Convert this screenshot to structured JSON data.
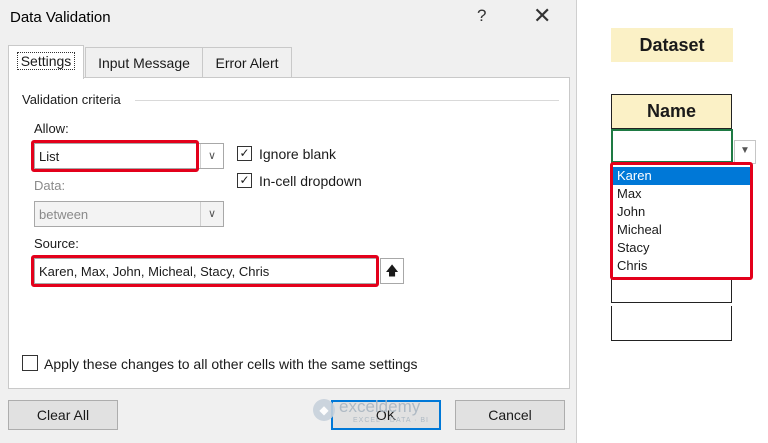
{
  "dialog": {
    "title": "Data Validation",
    "help_glyph": "?",
    "close_glyph": "✕",
    "tabs": [
      {
        "label": "Settings",
        "active": true
      },
      {
        "label": "Input Message",
        "active": false
      },
      {
        "label": "Error Alert",
        "active": false
      }
    ],
    "group_label": "Validation criteria",
    "allow": {
      "label": "Allow:",
      "value": "List"
    },
    "data": {
      "label": "Data:",
      "value": "between",
      "disabled": true
    },
    "ignore_blank": {
      "label": "Ignore blank",
      "checked": true
    },
    "in_cell_dropdown": {
      "label": "In-cell dropdown",
      "checked": true
    },
    "source": {
      "label": "Source:",
      "value": "Karen, Max, John, Micheal, Stacy, Chris",
      "button_glyph": "🡅"
    },
    "apply_all": {
      "label": "Apply these changes to all other cells with the same settings",
      "checked": false
    },
    "buttons": {
      "clear_all": "Clear All",
      "ok": "OK",
      "cancel": "Cancel"
    },
    "highlight_color": "#e3001b",
    "accent_color": "#0078d7"
  },
  "watermark": {
    "name": "exceldemy",
    "tagline": "EXCEL · DATA · BI"
  },
  "sheet": {
    "dataset_title": "Dataset",
    "column_header": "Name",
    "header_fill": "#fbf1c6",
    "dropdown_glyph": "▼",
    "dropdown_options": [
      "Karen",
      "Max",
      "John",
      "Micheal",
      "Stacy",
      "Chris"
    ],
    "selected_option": "Karen"
  }
}
